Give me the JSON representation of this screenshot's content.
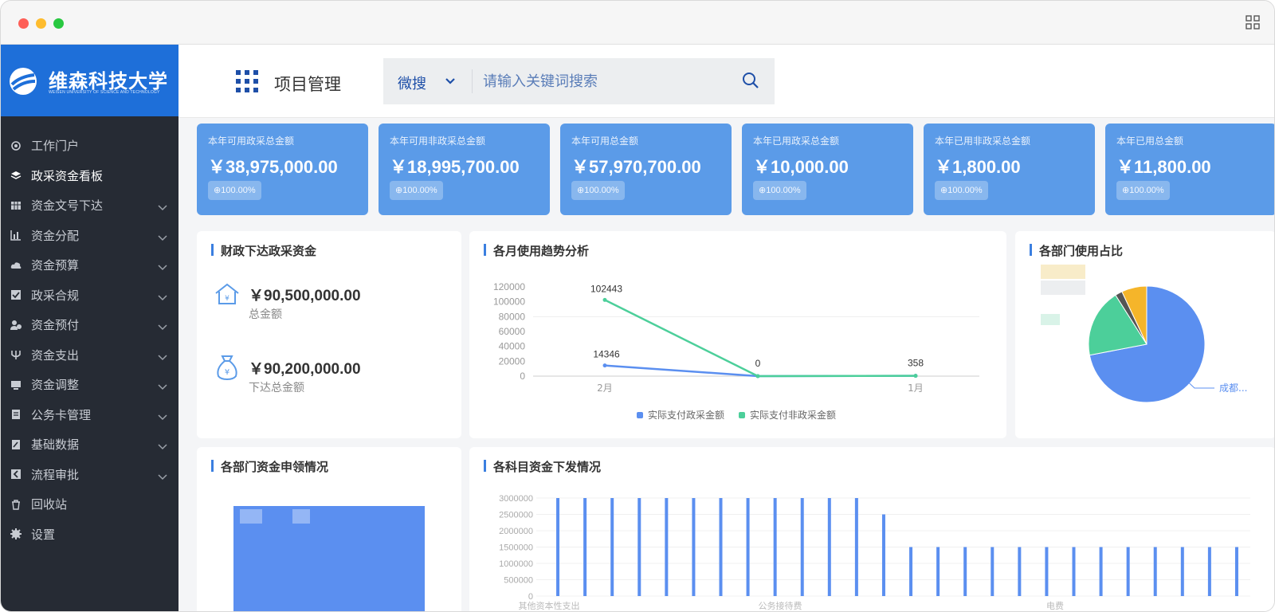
{
  "window": {
    "grid_icon": "grid-icon"
  },
  "sidebar": {
    "logo_title": "维森科技大学",
    "logo_subtitle": "WEISEN UNIVERSITY OF SCIENCE AND TECHNOLOGY",
    "items": [
      {
        "label": "工作门户",
        "icon": "at-icon",
        "has_caret": false
      },
      {
        "label": "政采资金看板",
        "icon": "layers-icon",
        "has_caret": false,
        "active": true
      },
      {
        "label": "资金文号下达",
        "icon": "table-icon",
        "has_caret": true
      },
      {
        "label": "资金分配",
        "icon": "bar-chart-icon",
        "has_caret": true
      },
      {
        "label": "资金预算",
        "icon": "cloud-icon",
        "has_caret": true
      },
      {
        "label": "政采合规",
        "icon": "checkbox-icon",
        "has_caret": true
      },
      {
        "label": "资金预付",
        "icon": "user-money-icon",
        "has_caret": true
      },
      {
        "label": "资金支出",
        "icon": "fork-icon",
        "has_caret": true
      },
      {
        "label": "资金调整",
        "icon": "monitor-icon",
        "has_caret": true
      },
      {
        "label": "公务卡管理",
        "icon": "card-icon",
        "has_caret": true
      },
      {
        "label": "基础数据",
        "icon": "edit-doc-icon",
        "has_caret": true
      },
      {
        "label": "流程审批",
        "icon": "back-square-icon",
        "has_caret": true
      },
      {
        "label": "回收站",
        "icon": "trash-icon",
        "has_caret": false
      },
      {
        "label": "设置",
        "icon": "gear-icon",
        "has_caret": false
      }
    ]
  },
  "header": {
    "title": "项目管理",
    "search_type": "微搜",
    "search_placeholder": "请输入关键词搜索"
  },
  "cards": [
    {
      "label": "本年可用政采总金额",
      "value": "￥38,975,000.00",
      "badge": "⊕100.00%"
    },
    {
      "label": "本年可用非政采总金额",
      "value": "￥18,995,700.00",
      "badge": "⊕100.00%"
    },
    {
      "label": "本年可用总金额",
      "value": "￥57,970,700.00",
      "badge": "⊕100.00%"
    },
    {
      "label": "本年已用政采总金额",
      "value": "￥10,000.00",
      "badge": "⊕100.00%"
    },
    {
      "label": "本年已用非政采总金额",
      "value": "￥1,800.00",
      "badge": "⊕100.00%"
    },
    {
      "label": "本年已用总金额",
      "value": "￥11,800.00",
      "badge": "⊕100.00%"
    }
  ],
  "fund_panel": {
    "title": "财政下达政采资金",
    "total_amount": "￥90,500,000.00",
    "total_label": "总金额",
    "issued_amount": "￥90,200,000.00",
    "issued_label": "下达总金额"
  },
  "trend_panel": {
    "title": "各月使用趋势分析"
  },
  "dept_share_panel": {
    "title": "各部门使用占比",
    "label_visible": "成都..."
  },
  "dept_apply_panel": {
    "title": "各部门资金申领情况"
  },
  "subject_panel": {
    "title": "各科目资金下发情况"
  },
  "colors": {
    "accent": "#1e6fd9",
    "card": "#5b9be8",
    "series_blue": "#5b8ff0",
    "series_green": "#4ccf9a",
    "pie_orange": "#f5b52a"
  },
  "chart_data": [
    {
      "type": "line",
      "title": "",
      "x": [
        "2月",
        "",
        "1月"
      ],
      "series": [
        {
          "name": "实际支付政采金额",
          "values": [
            14346,
            0,
            358
          ]
        },
        {
          "name": "实际支付非政采金额",
          "values": [
            102443,
            0,
            358
          ]
        }
      ],
      "point_labels": [
        "102443",
        "14346",
        "0",
        "358"
      ],
      "ylim": [
        0,
        120000
      ],
      "yticks": [
        "120000",
        "100000",
        "80000",
        "60000",
        "40000",
        "20000",
        "0"
      ],
      "legend": "bottom"
    },
    {
      "type": "pie",
      "slices": [
        {
          "label": "成都...",
          "value": 72
        },
        {
          "label": "",
          "value": 19
        },
        {
          "label": "",
          "value": 2
        },
        {
          "label": "",
          "value": 7
        }
      ]
    },
    {
      "type": "bar",
      "ylim": [
        0,
        3000000
      ],
      "yticks": [
        "3000000",
        "2500000",
        "2000000",
        "1500000",
        "1000000",
        "500000",
        "0"
      ],
      "xlabels": [
        "其他资本性支出",
        "公务接待费",
        "电费"
      ],
      "values": [
        3000000,
        3000000,
        3000000,
        3000000,
        3000000,
        3000000,
        3000000,
        3000000,
        3000000,
        3000000,
        3000000,
        3000000,
        2500000,
        1500000,
        1500000,
        1500000,
        1500000,
        1500000,
        1500000,
        1500000,
        1500000,
        1500000,
        1500000,
        1500000,
        1500000,
        1500000
      ]
    }
  ]
}
